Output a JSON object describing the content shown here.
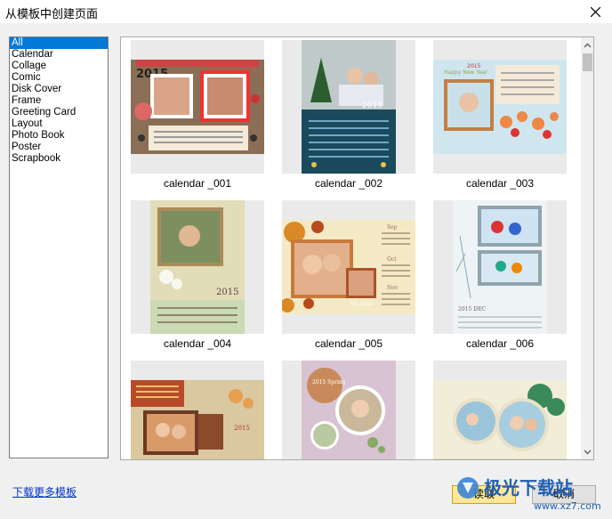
{
  "window": {
    "title": "从模板中创建页面"
  },
  "categories": [
    "All",
    "Calendar",
    "Collage",
    "Comic",
    "Disk Cover",
    "Frame",
    "Greeting Card",
    "Layout",
    "Photo Book",
    "Poster",
    "Scrapbook"
  ],
  "selected_category": "All",
  "templates": [
    {
      "name": "calendar _001",
      "year": "2015"
    },
    {
      "name": "calendar _002",
      "year": "2015"
    },
    {
      "name": "calendar _003",
      "year": "2015",
      "greeting": "Happy New Year"
    },
    {
      "name": "calendar _004",
      "year": "2015"
    },
    {
      "name": "calendar _005",
      "months": [
        "Sep",
        "Oct",
        "Nov"
      ],
      "tag": "For 2015"
    },
    {
      "name": "calendar _006",
      "month_label": "2015 DEC"
    },
    {
      "name": "",
      "year": "2015"
    },
    {
      "name": "",
      "banner": "2015 Spring"
    },
    {
      "name": ""
    }
  ],
  "footer": {
    "more_link": "下载更多模板",
    "read_button": "读取",
    "cancel_button": "取消"
  },
  "watermark": {
    "brand": "极光下载站",
    "url": "www.xz7.com"
  },
  "colors": {
    "selection": "#0078d7",
    "primary_button": "#fce89a",
    "link": "#0033cc"
  }
}
